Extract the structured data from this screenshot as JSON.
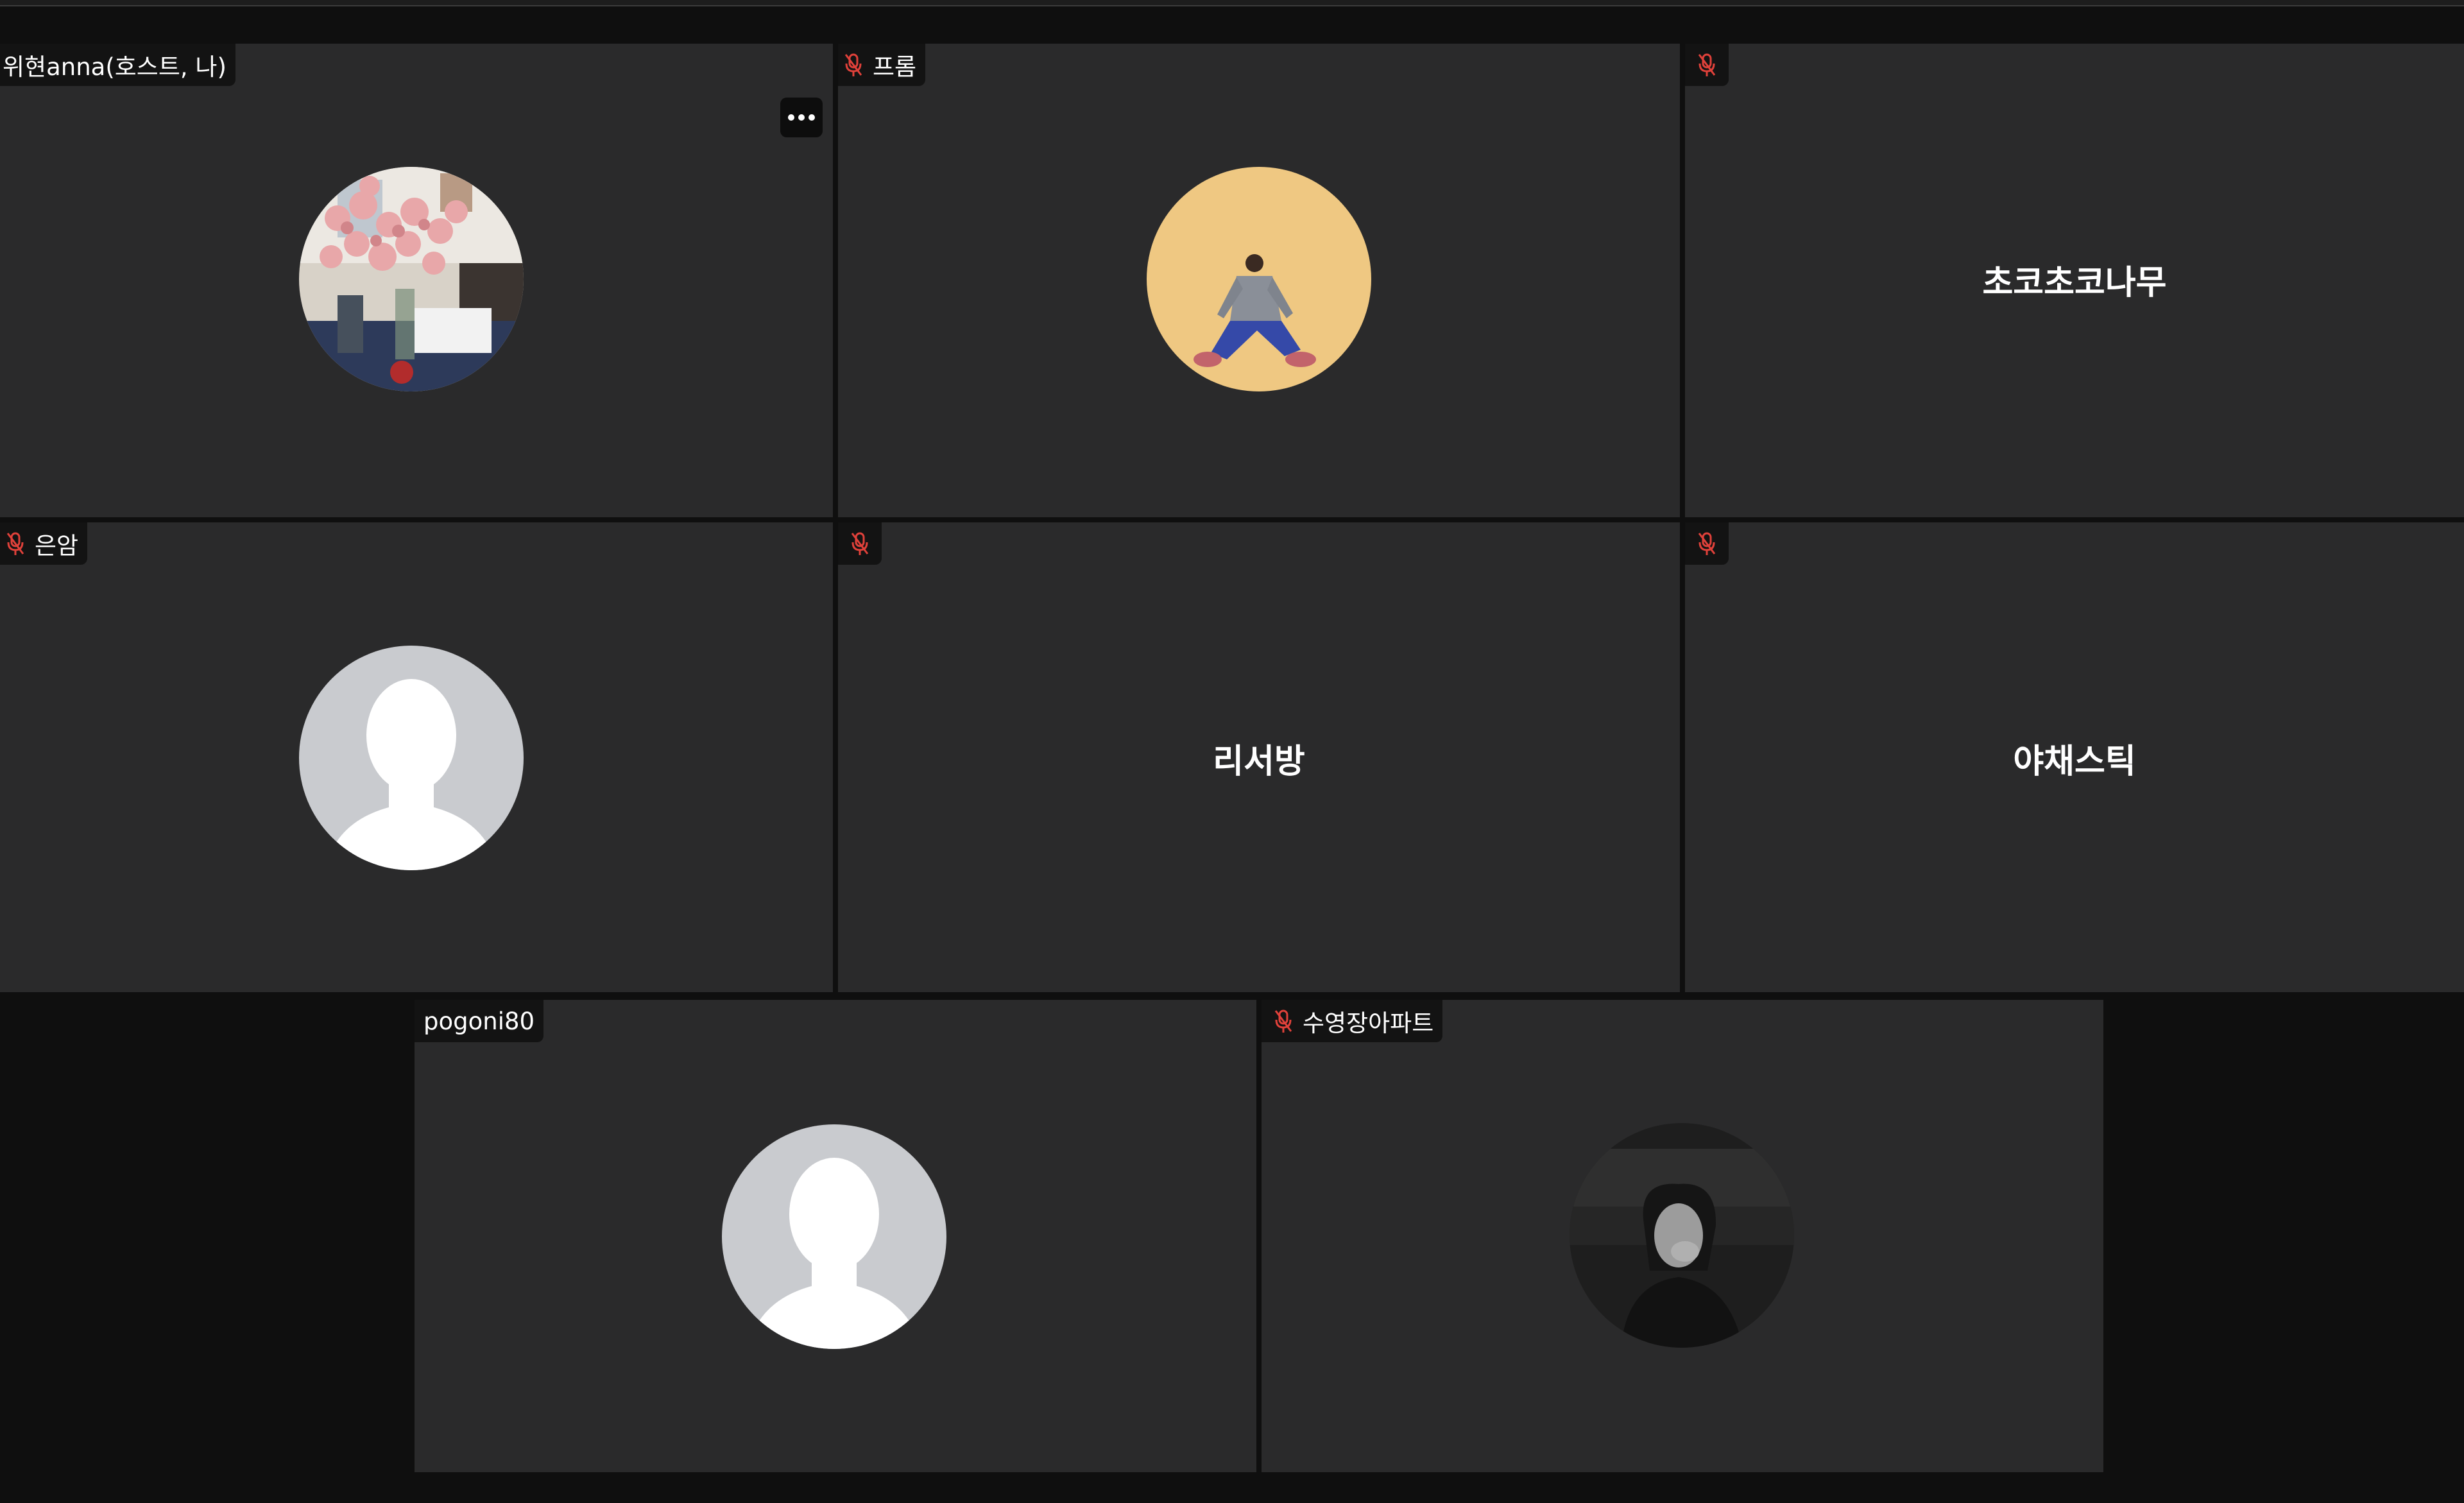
{
  "participants": [
    {
      "name": "위현anna(호스트, 나)",
      "muted": false,
      "display": "photo",
      "photo": "flowers-desk"
    },
    {
      "name": "프롬",
      "muted": true,
      "display": "photo",
      "photo": "person-sitting-yellow"
    },
    {
      "name": "",
      "muted": true,
      "display": "text",
      "center_text": "초코초코나무"
    },
    {
      "name": "은암",
      "muted": true,
      "display": "placeholder-avatar"
    },
    {
      "name": "",
      "muted": true,
      "display": "text",
      "center_text": "리서방"
    },
    {
      "name": "",
      "muted": true,
      "display": "text",
      "center_text": "야채스틱"
    },
    {
      "name": "pogoni80",
      "muted": false,
      "display": "placeholder-avatar"
    },
    {
      "name": "수영장아파트",
      "muted": true,
      "display": "photo",
      "photo": "woman-bw"
    }
  ],
  "icons": {
    "mic_muted": "mic-muted-icon",
    "more": "more-options-icon"
  },
  "colors": {
    "tile_bg": "#2a2a2b",
    "page_bg": "#0f0f0f",
    "muted_red": "#e0413a",
    "placeholder_avatar_bg": "#c9cbcf"
  }
}
